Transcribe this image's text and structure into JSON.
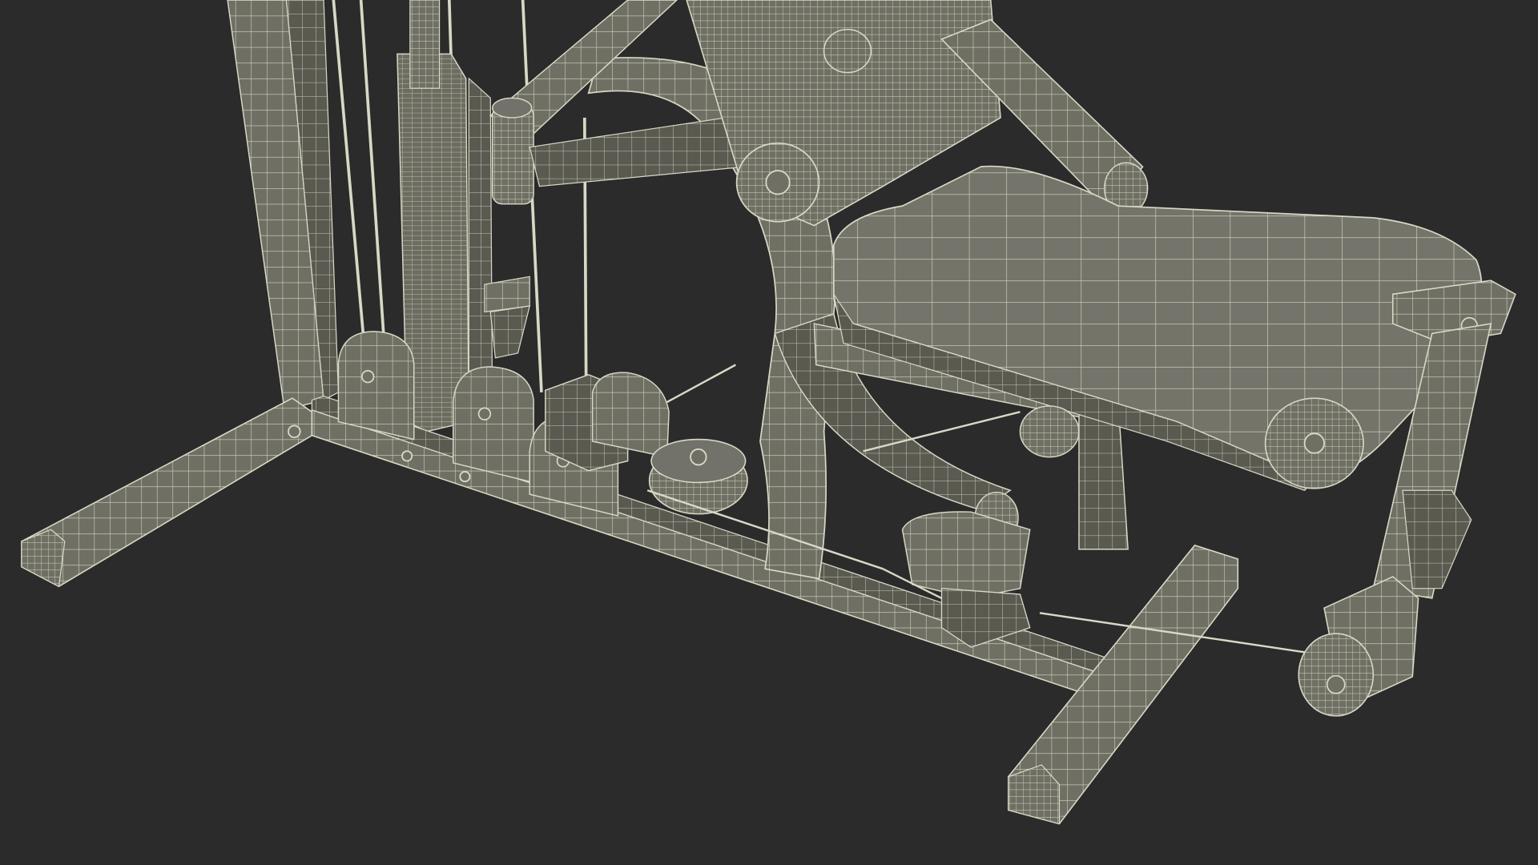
{
  "scene": {
    "subject": "home-gym-wireframe",
    "colors": {
      "background": "#2b2b2b",
      "face": "#6f6f64",
      "face_dark": "#5a5a51",
      "face_light": "#7c7c70",
      "wire": "#d8d8c6",
      "wire_faint": "#bdbdab"
    }
  }
}
